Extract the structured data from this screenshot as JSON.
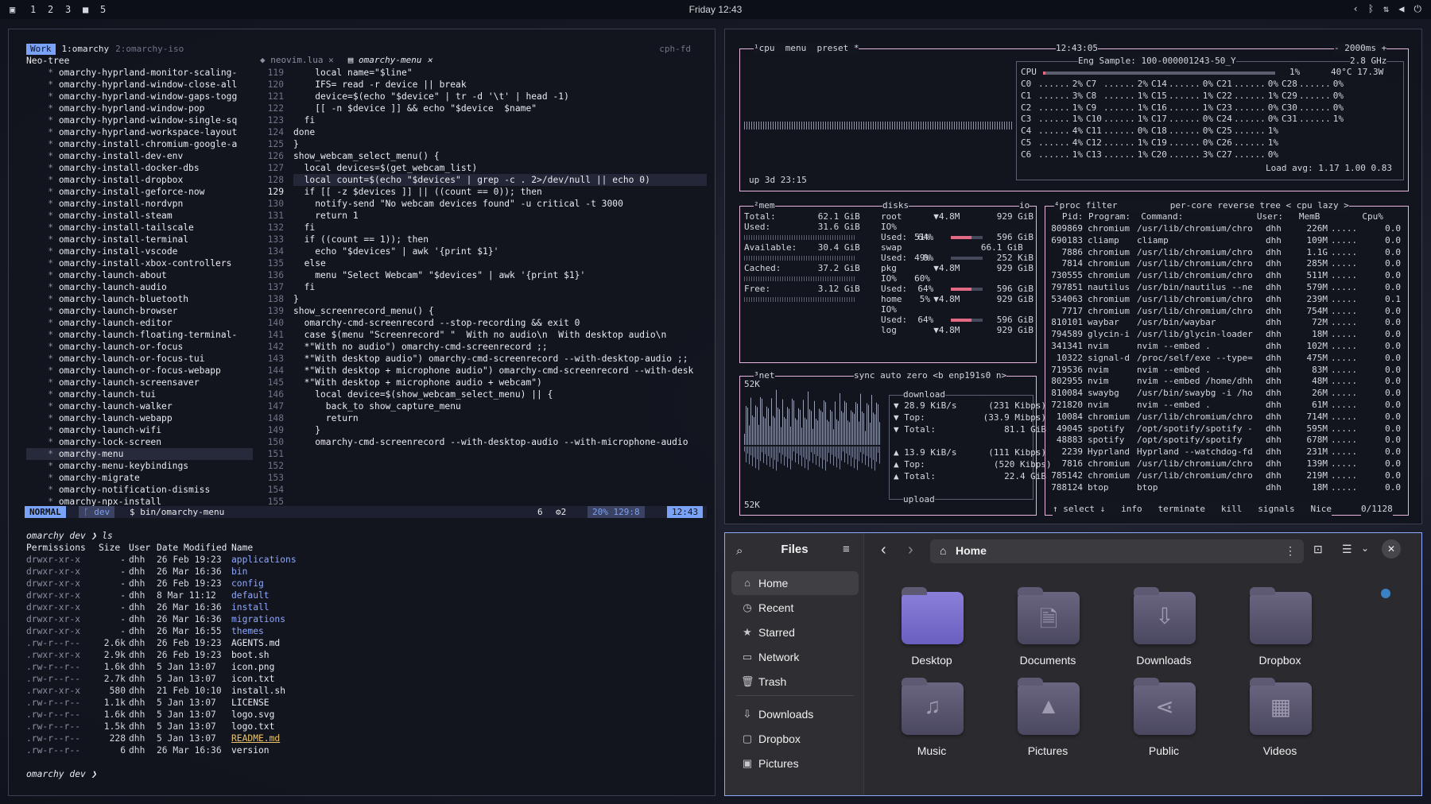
{
  "topbar": {
    "workspaces": [
      "1",
      "2",
      "3",
      "4",
      "5"
    ],
    "clock": "Friday 12:43"
  },
  "nvim": {
    "tabs": {
      "left": "Work",
      "session1": "1:omarchy",
      "session2": "2:omarchy-iso",
      "host": "cph-fd"
    },
    "tree_title": "Neo-tree",
    "tree": [
      "omarchy-hyprland-monitor-scaling-",
      "omarchy-hyprland-window-close-all",
      "omarchy-hyprland-window-gaps-togg",
      "omarchy-hyprland-window-pop",
      "omarchy-hyprland-window-single-sq",
      "omarchy-hyprland-workspace-layout",
      "omarchy-install-chromium-google-a",
      "omarchy-install-dev-env",
      "omarchy-install-docker-dbs",
      "omarchy-install-dropbox",
      "omarchy-install-geforce-now",
      "omarchy-install-nordvpn",
      "omarchy-install-steam",
      "omarchy-install-tailscale",
      "omarchy-install-terminal",
      "omarchy-install-vscode",
      "omarchy-install-xbox-controllers",
      "omarchy-launch-about",
      "omarchy-launch-audio",
      "omarchy-launch-bluetooth",
      "omarchy-launch-browser",
      "omarchy-launch-editor",
      "omarchy-launch-floating-terminal-",
      "omarchy-launch-or-focus",
      "omarchy-launch-or-focus-tui",
      "omarchy-launch-or-focus-webapp",
      "omarchy-launch-screensaver",
      "omarchy-launch-tui",
      "omarchy-launch-walker",
      "omarchy-launch-webapp",
      "omarchy-launch-wifi",
      "omarchy-lock-screen",
      "omarchy-menu",
      "omarchy-menu-keybindings",
      "omarchy-migrate",
      "omarchy-notification-dismiss",
      "omarchy-npx-install"
    ],
    "buffers": [
      "neovim.lua",
      "omarchy-menu"
    ],
    "line_numbers": [
      "119",
      "120",
      "121",
      "122",
      "123",
      "124",
      "125",
      "126",
      "127",
      "128",
      "129",
      "130",
      "131",
      "132",
      "133",
      "134",
      "135",
      "136",
      "137",
      "138",
      "139",
      "140",
      "141",
      "142",
      "143",
      "144",
      "145",
      "146",
      "147",
      "148",
      "149",
      "150",
      "151",
      "152",
      "153",
      "154",
      "155"
    ],
    "code": [
      "    local name=\"$line\"",
      "    IFS= read -r device || break",
      "    device=$(echo \"$device\" | tr -d '\\t' | head -1)",
      "    [[ -n $device ]] && echo \"$device  $name\"",
      "  fi",
      "done",
      "}",
      "",
      "show_webcam_select_menu() {",
      "  local devices=$(get_webcam_list)",
      "  local count=$(echo \"$devices\" | grep -c . 2>/dev/null || echo 0)",
      "",
      "  if [[ -z $devices ]] || ((count == 0)); then",
      "    notify-send \"No webcam devices found\" -u critical -t 3000",
      "    return 1",
      "  fi",
      "",
      "  if ((count == 1)); then",
      "    echo \"$devices\" | awk '{print $1}'",
      "  else",
      "    menu \"Select Webcam\" \"$devices\" | awk '{print $1}'",
      "  fi",
      "}",
      "",
      "show_screenrecord_menu() {",
      "  omarchy-cmd-screenrecord --stop-recording && exit 0",
      "",
      "  case $(menu \"Screenrecord\" \"  With no audio\\n  With desktop audio\\n",
      "  *\"With no audio\") omarchy-cmd-screenrecord ;;",
      "  *\"With desktop audio\") omarchy-cmd-screenrecord --with-desktop-audio ;;",
      "  *\"With desktop + microphone audio\") omarchy-cmd-screenrecord --with-desk",
      "  *\"With desktop + microphone audio + webcam\")",
      "    local device=$(show_webcam_select_menu) || {",
      "      back_to show_capture_menu",
      "      return",
      "    }",
      "    omarchy-cmd-screenrecord --with-desktop-audio --with-microphone-audio"
    ],
    "status": {
      "mode": "NORMAL",
      "branch": "dev",
      "path": "bin/omarchy-menu",
      "diag": "6",
      "warn": "2",
      "pos": "20% 129:8",
      "time": "12:43"
    },
    "shell": {
      "prompt1": "omarchy dev ❯ ls",
      "headers": [
        "Permissions",
        "Size",
        "User",
        "Date Modified",
        "Name"
      ],
      "rows": [
        [
          "drwxr-xr-x",
          "-",
          "dhh",
          "26 Feb 19:23",
          "applications"
        ],
        [
          "drwxr-xr-x",
          "-",
          "dhh",
          "26 Mar 16:36",
          "bin"
        ],
        [
          "drwxr-xr-x",
          "-",
          "dhh",
          "26 Feb 19:23",
          "config"
        ],
        [
          "drwxr-xr-x",
          "-",
          "dhh",
          "8 Mar 11:12",
          "default"
        ],
        [
          "drwxr-xr-x",
          "-",
          "dhh",
          "26 Mar 16:36",
          "install"
        ],
        [
          "drwxr-xr-x",
          "-",
          "dhh",
          "26 Mar 16:36",
          "migrations"
        ],
        [
          "drwxr-xr-x",
          "-",
          "dhh",
          "26 Mar 16:55",
          "themes"
        ],
        [
          ".rw-r--r--",
          "2.6k",
          "dhh",
          "26 Feb 19:23",
          "AGENTS.md"
        ],
        [
          ".rwxr-xr-x",
          "2.9k",
          "dhh",
          "26 Feb 19:23",
          "boot.sh"
        ],
        [
          ".rw-r--r--",
          "1.6k",
          "dhh",
          "5 Jan 13:07",
          "icon.png"
        ],
        [
          ".rw-r--r--",
          "2.7k",
          "dhh",
          "5 Jan 13:07",
          "icon.txt"
        ],
        [
          ".rwxr-xr-x",
          "580",
          "dhh",
          "21 Feb 10:10",
          "install.sh"
        ],
        [
          ".rw-r--r--",
          "1.1k",
          "dhh",
          "5 Jan 13:07",
          "LICENSE"
        ],
        [
          ".rw-r--r--",
          "1.6k",
          "dhh",
          "5 Jan 13:07",
          "logo.svg"
        ],
        [
          ".rw-r--r--",
          "1.5k",
          "dhh",
          "5 Jan 13:07",
          "logo.txt"
        ],
        [
          ".rw-r--r--",
          "228",
          "dhh",
          "5 Jan 13:07",
          "README.md"
        ],
        [
          ".rw-r--r--",
          "6",
          "dhh",
          "26 Mar 16:36",
          "version"
        ]
      ],
      "prompt2": "omarchy dev ❯"
    }
  },
  "btop": {
    "cpu_title": "¹cpu",
    "menu": "menu",
    "preset": "preset *",
    "clock": "12:43:05",
    "rate": "- 2000ms +",
    "model": "Eng Sample: 100-000001243-50_Y",
    "freq": "2.8 GHz",
    "total_pct": "1%",
    "temp": "40°C 17.3W",
    "cores": [
      [
        "C0",
        "2%"
      ],
      [
        "C1",
        "3%"
      ],
      [
        "C2",
        "1%"
      ],
      [
        "C3",
        "1%"
      ],
      [
        "C4",
        "4%"
      ],
      [
        "C5",
        "4%"
      ],
      [
        "C6",
        "1%"
      ],
      [
        "C7",
        "2%"
      ],
      [
        "C8",
        "1%"
      ],
      [
        "C9",
        "1%"
      ],
      [
        "C10",
        "1%"
      ],
      [
        "C11",
        "0%"
      ],
      [
        "C12",
        "1%"
      ],
      [
        "C13",
        "1%"
      ],
      [
        "C14",
        "0%"
      ],
      [
        "C15",
        "1%"
      ],
      [
        "C16",
        "1%"
      ],
      [
        "C17",
        "0%"
      ],
      [
        "C18",
        "0%"
      ],
      [
        "C19",
        "0%"
      ],
      [
        "C20",
        "3%"
      ],
      [
        "C21",
        "0%"
      ],
      [
        "C22",
        "1%"
      ],
      [
        "C23",
        "0%"
      ],
      [
        "C24",
        "0%"
      ],
      [
        "C25",
        "1%"
      ],
      [
        "C26",
        "1%"
      ],
      [
        "C27",
        "0%"
      ],
      [
        "C28",
        "0%"
      ],
      [
        "C29",
        "0%"
      ],
      [
        "C30",
        "0%"
      ],
      [
        "C31",
        "1%"
      ]
    ],
    "load": "Load avg: 1.17 1.00 0.83",
    "uptime": "up 3d 23:15",
    "mem": {
      "title": "²mem",
      "total": "Total:        62.1 GiB",
      "used": "Used:         31.6 GiB",
      "used_pct": "51%",
      "avail": "Available:    30.4 GiB",
      "avail_pct": "49%",
      "cached": "Cached:       37.2 GiB",
      "cached_pct": "60%",
      "free": "Free:         3.12 GiB",
      "free_pct": "5%"
    },
    "disks": {
      "title": "disks",
      "io": "io",
      "rows": [
        "root      ▼4.8M       929 GiB",
        "IO%",
        "Used:  64%            596 GiB",
        "swap               66.1 GiB",
        "Used:   0%            252 KiB",
        "pkg       ▼4.8M       929 GiB",
        "IO%",
        "Used:  64%            596 GiB",
        "home      ▼4.8M       929 GiB",
        "IO%",
        "Used:  64%            596 GiB",
        "log       ▼4.8M       929 GiB"
      ]
    },
    "net": {
      "title": "³net",
      "sync": "sync",
      "auto": "auto",
      "zero": "zero",
      "iface": "<b enp191s0 n>",
      "scale_top": "52K",
      "scale_bot": "52K",
      "download": "download",
      "rows": [
        "▼ 28.9 KiB/s      (231 Kibps)",
        "▼ Top:           (33.9 Mibps)",
        "▼ Total:             81.1 GiB",
        "",
        "▲ 13.9 KiB/s      (111 Kibps)",
        "▲ Top:             (520 Kibps)",
        "▲ Total:             22.4 GiB"
      ],
      "upload": "upload"
    },
    "proc": {
      "title": "⁴proc",
      "filter": "filter",
      "percore": "per-core",
      "reverse": "reverse",
      "tree": "tree",
      "sort": "< cpu lazy >",
      "header": "   Pid: Program:  Command:              User:   MemB        Cpu%",
      "rows": [
        [
          "809869",
          "chromium",
          "/usr/lib/chromium/chro",
          "dhh",
          "226M",
          "0.0"
        ],
        [
          "690183",
          "cliamp",
          "cliamp",
          "dhh",
          "109M",
          "0.0"
        ],
        [
          "7886",
          "chromium",
          "/usr/lib/chromium/chro",
          "dhh",
          "1.1G",
          "0.0"
        ],
        [
          "7814",
          "chromium",
          "/usr/lib/chromium/chro",
          "dhh",
          "285M",
          "0.0"
        ],
        [
          "730555",
          "chromium",
          "/usr/lib/chromium/chro",
          "dhh",
          "511M",
          "0.0"
        ],
        [
          "797851",
          "nautilus",
          "/usr/bin/nautilus --ne",
          "dhh",
          "579M",
          "0.0"
        ],
        [
          "534063",
          "chromium",
          "/usr/lib/chromium/chro",
          "dhh",
          "239M",
          "0.1"
        ],
        [
          "7717",
          "chromium",
          "/usr/lib/chromium/chro",
          "dhh",
          "754M",
          "0.0"
        ],
        [
          "810101",
          "waybar",
          "/usr/bin/waybar",
          "dhh",
          "72M",
          "0.0"
        ],
        [
          "794589",
          "glycin-i",
          "/usr/lib/glycin-loader",
          "dhh",
          "18M",
          "0.0"
        ],
        [
          "341341",
          "nvim",
          "nvim --embed .",
          "dhh",
          "102M",
          "0.0"
        ],
        [
          "10322",
          "signal-d",
          "/proc/self/exe --type=",
          "dhh",
          "475M",
          "0.0"
        ],
        [
          "719536",
          "nvim",
          "nvim --embed .",
          "dhh",
          "83M",
          "0.0"
        ],
        [
          "802955",
          "nvim",
          "nvim --embed /home/dhh",
          "dhh",
          "48M",
          "0.0"
        ],
        [
          "810084",
          "swaybg",
          "/usr/bin/swaybg -i /ho",
          "dhh",
          "26M",
          "0.0"
        ],
        [
          "721820",
          "nvim",
          "nvim --embed .",
          "dhh",
          "61M",
          "0.0"
        ],
        [
          "10084",
          "chromium",
          "/usr/lib/chromium/chro",
          "dhh",
          "714M",
          "0.0"
        ],
        [
          "49045",
          "spotify",
          "/opt/spotify/spotify -",
          "dhh",
          "595M",
          "0.0"
        ],
        [
          "48883",
          "spotify",
          "/opt/spotify/spotify",
          "dhh",
          "678M",
          "0.0"
        ],
        [
          "2239",
          "Hyprland",
          "Hyprland --watchdog-fd",
          "dhh",
          "231M",
          "0.0"
        ],
        [
          "7816",
          "chromium",
          "/usr/lib/chromium/chro",
          "dhh",
          "139M",
          "0.0"
        ],
        [
          "785142",
          "chromium",
          "/usr/lib/chromium/chro",
          "dhh",
          "219M",
          "0.0"
        ],
        [
          "788124",
          "btop",
          "btop",
          "dhh",
          "18M",
          "0.0"
        ]
      ],
      "footer": "↑ select ↓   info   terminate   kill   signals   Nice",
      "count": "0/1128"
    }
  },
  "files": {
    "title": "Files",
    "location": "Home",
    "sidebar": [
      {
        "label": "Home",
        "icon": "⌂"
      },
      {
        "label": "Recent",
        "icon": "◷"
      },
      {
        "label": "Starred",
        "icon": "★"
      },
      {
        "label": "Network",
        "icon": "▭"
      },
      {
        "label": "Trash",
        "icon": "🗑"
      },
      {
        "label": "Downloads",
        "icon": "⇩"
      },
      {
        "label": "Dropbox",
        "icon": "▢"
      },
      {
        "label": "Pictures",
        "icon": "▣"
      }
    ],
    "folders": [
      {
        "label": "Desktop",
        "glyph": ""
      },
      {
        "label": "Documents",
        "glyph": "🗎"
      },
      {
        "label": "Downloads",
        "glyph": "⇩"
      },
      {
        "label": "Dropbox",
        "glyph": ""
      },
      {
        "label": "Music",
        "glyph": "♫"
      },
      {
        "label": "Pictures",
        "glyph": "▲"
      },
      {
        "label": "Public",
        "glyph": "⋖"
      },
      {
        "label": "Videos",
        "glyph": "▦"
      }
    ]
  },
  "colors": {
    "accent": "#8fa9ff",
    "btop_border": "#e6b6dd",
    "nvim_mode": "#7aa2f7",
    "keyword": "#e47b56",
    "string": "#d6ad6e"
  }
}
